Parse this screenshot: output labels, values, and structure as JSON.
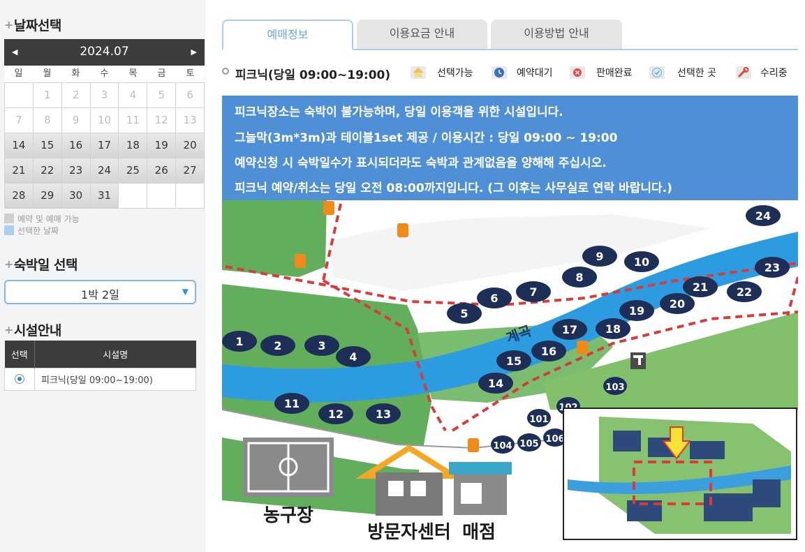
{
  "sections": {
    "date_title": "날짜선택",
    "stay_title": "숙박일 선택",
    "facility_title": "시설안내"
  },
  "calendar": {
    "month": "2024.07",
    "weekdays": [
      "일",
      "월",
      "화",
      "수",
      "목",
      "금",
      "토"
    ],
    "weeks": [
      [
        null,
        1,
        2,
        3,
        4,
        5,
        6
      ],
      [
        7,
        8,
        9,
        10,
        11,
        12,
        13
      ],
      [
        14,
        15,
        16,
        17,
        18,
        19,
        20
      ],
      [
        21,
        22,
        23,
        24,
        25,
        26,
        27
      ],
      [
        28,
        29,
        30,
        31,
        null,
        null,
        null
      ]
    ],
    "first_available_day": 14
  },
  "legend": {
    "available": "예약 및 예매 가능",
    "selected": "선택한 날짜"
  },
  "stay_select": {
    "value": "1박 2일"
  },
  "facility_table": {
    "headers": [
      "선택",
      "시설명"
    ],
    "rows": [
      {
        "name": "피크닉(당일 09:00~19:00)"
      }
    ]
  },
  "tabs": [
    "예매정보",
    "이용요금 안내",
    "이용방법 안내"
  ],
  "facility_title": "피크닉(당일 09:00~19:00)",
  "status_legend": [
    {
      "label": "선택가능",
      "icon": "house-icon"
    },
    {
      "label": "예약대기",
      "icon": "clock-icon"
    },
    {
      "label": "판매완료",
      "icon": "sold-out-icon"
    },
    {
      "label": "선택한 곳",
      "icon": "check-icon"
    },
    {
      "label": "수리중",
      "icon": "wrench-icon"
    }
  ],
  "notice_lines": [
    "피크닉장소는 숙박이 불가능하며, 당일 이용객을 위한 시설입니다.",
    "그늘막(3m*3m)과 테이블1set 제공 / 이용시간 : 당일 09:00 ~ 19:00",
    "예약신청 시 숙박일수가 표시되더라도 숙박과 관계없음을 양해해 주십시오.",
    "피크닉 예약/취소는 당일 오전 08:00까지입니다. (그 이후는 사무실로 연락 바랍니다.)"
  ],
  "map": {
    "stream_label": "계곡",
    "sites": [
      "1",
      "2",
      "3",
      "4",
      "5",
      "6",
      "7",
      "8",
      "9",
      "10",
      "11",
      "12",
      "13",
      "14",
      "15",
      "16",
      "17",
      "18",
      "19",
      "20",
      "21",
      "22",
      "23",
      "24",
      "101",
      "102",
      "103",
      "104",
      "105",
      "106"
    ],
    "buildings": {
      "basketball": "농구장",
      "visitor_center": "방문자센터",
      "store": "매점"
    }
  },
  "colors": {
    "header_dark": "#3c3c3c",
    "notice_blue": "#4f8fd5",
    "tab_active_text": "#6ca5d8",
    "river": "#2c9be0",
    "site_marker": "#1e2f57",
    "path_red": "#d93a3a"
  }
}
